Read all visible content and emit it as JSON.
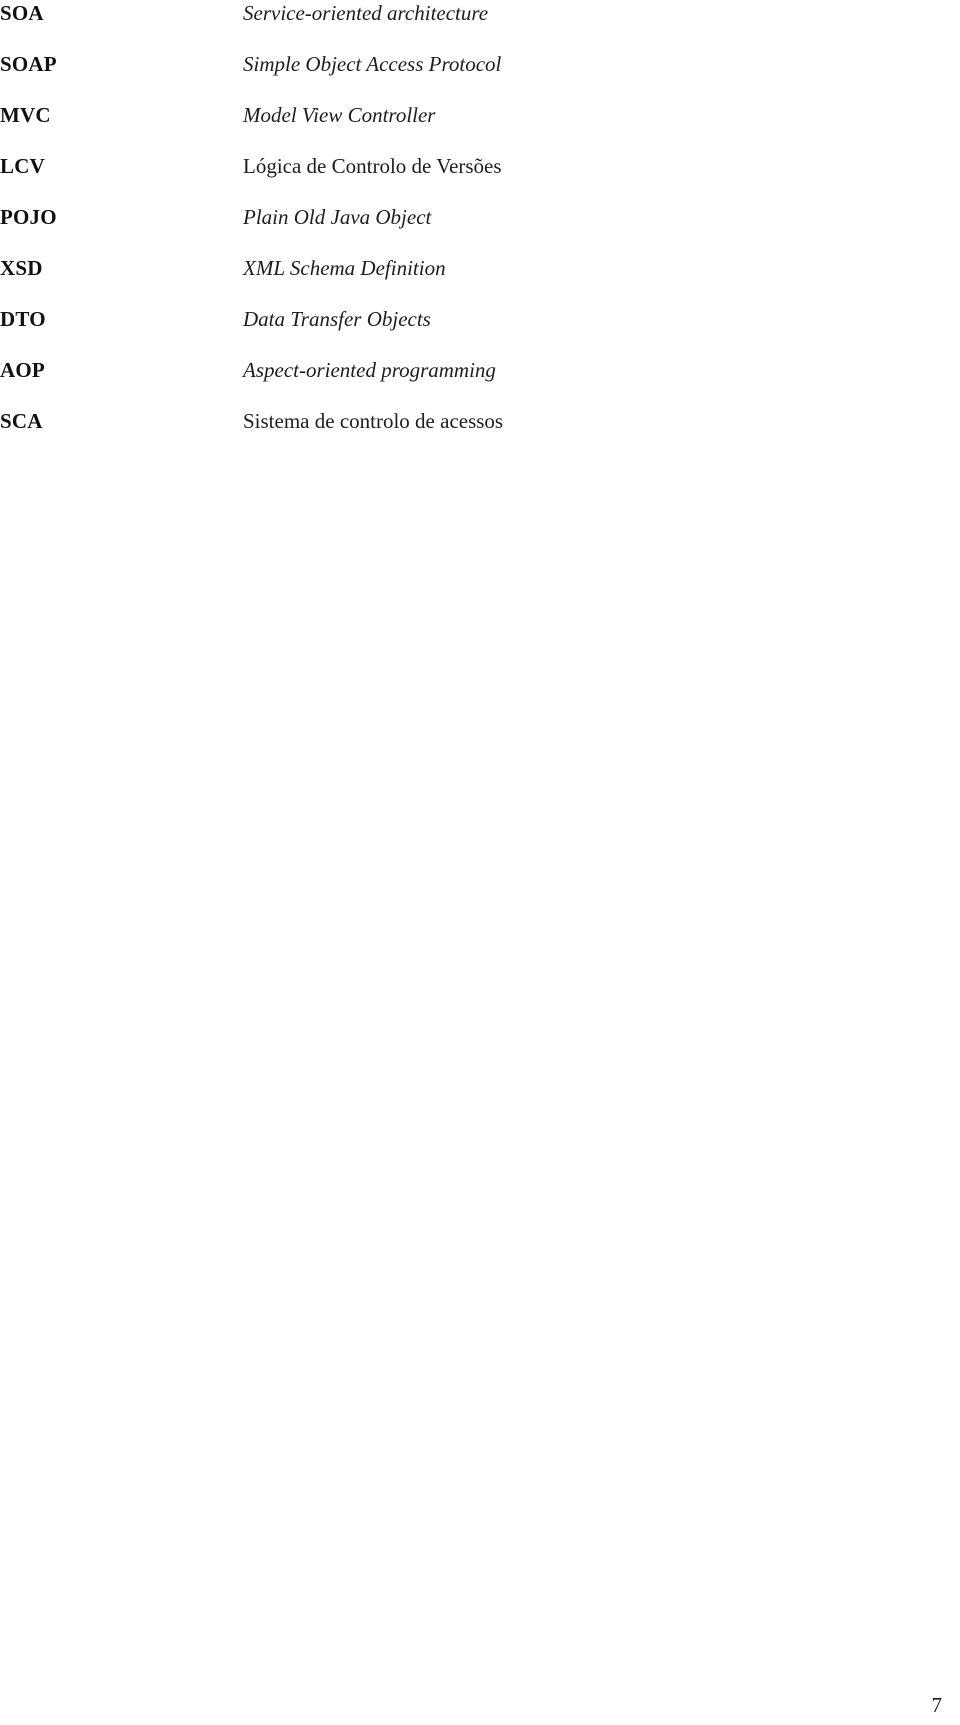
{
  "document": {
    "type": "glossary-of-abbreviations",
    "page_number": "7",
    "background_color": "#ffffff",
    "text_color": "#1a1a1a"
  },
  "abbreviations": [
    {
      "term": "SOA",
      "definition": "Service-oriented architecture",
      "style": "italic"
    },
    {
      "term": "SOAP",
      "definition": "Simple Object Access Protocol",
      "style": "italic"
    },
    {
      "term": "MVC",
      "definition": "Model View Controller",
      "style": "italic"
    },
    {
      "term": "LCV",
      "definition": "Lógica de Controlo de Versões",
      "style": "roman"
    },
    {
      "term": "POJO",
      "definition": "Plain Old Java Object",
      "style": "italic"
    },
    {
      "term": "XSD",
      "definition": "XML Schema Definition",
      "style": "italic"
    },
    {
      "term": "DTO",
      "definition": "Data Transfer Objects",
      "style": "italic"
    },
    {
      "term": "AOP",
      "definition": "Aspect-oriented programming",
      "style": "italic"
    },
    {
      "term": "SCA",
      "definition": "Sistema de controlo de acessos",
      "style": "roman"
    }
  ]
}
